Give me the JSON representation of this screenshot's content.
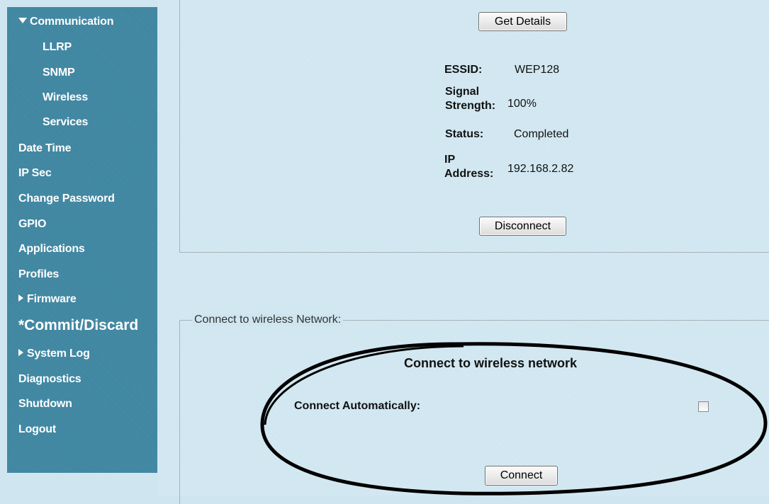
{
  "sidebar": {
    "items": [
      {
        "label": "Communication",
        "expanded": true
      },
      {
        "label": "LLRP"
      },
      {
        "label": "SNMP"
      },
      {
        "label": "Wireless"
      },
      {
        "label": "Services"
      },
      {
        "label": "Date Time"
      },
      {
        "label": "IP Sec"
      },
      {
        "label": "Change Password"
      },
      {
        "label": "GPIO"
      },
      {
        "label": "Applications"
      },
      {
        "label": "Profiles"
      },
      {
        "label": "Firmware",
        "expanded": false
      },
      {
        "label": "*Commit/Discard"
      },
      {
        "label": "System Log",
        "expanded": false
      },
      {
        "label": "Diagnostics"
      },
      {
        "label": "Shutdown"
      },
      {
        "label": "Logout"
      }
    ]
  },
  "status_panel": {
    "get_details_label": "Get Details",
    "essid_label": "ESSID:",
    "essid_value": "WEP128",
    "signal_label_line1": "Signal",
    "signal_label_line2": "Strength:",
    "signal_value": "100%",
    "status_label": "Status:",
    "status_value": "Completed",
    "ip_label_line1": "IP",
    "ip_label_line2": "Address:",
    "ip_value": "192.168.2.82",
    "disconnect_label": "Disconnect"
  },
  "connect_panel": {
    "legend": "Connect to wireless Network:",
    "title": "Connect to wireless network",
    "auto_label": "Connect Automatically:",
    "auto_checked": false,
    "connect_label": "Connect"
  },
  "colors": {
    "sidebar": "#3f86a1",
    "content": "#cfe6f0",
    "annotation": "#000000"
  }
}
